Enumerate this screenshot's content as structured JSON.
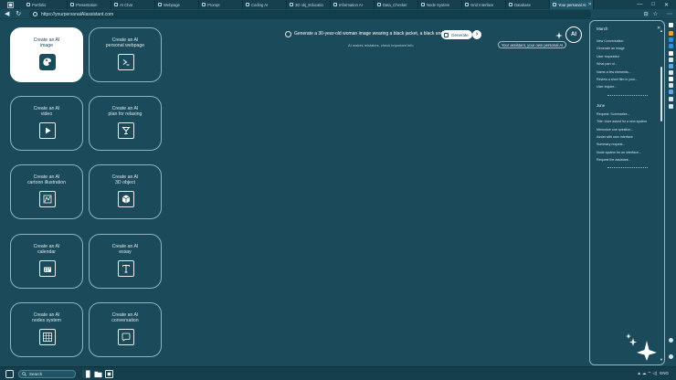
{
  "browser": {
    "tabs": [
      {
        "label": "Portfolio",
        "active": false
      },
      {
        "label": "Presentation",
        "active": false
      },
      {
        "label": "AI Chat",
        "active": false
      },
      {
        "label": "Webpage",
        "active": false
      },
      {
        "label": "Prompt",
        "active": false
      },
      {
        "label": "Coding AI",
        "active": false
      },
      {
        "label": "3D obj_Educatio",
        "active": false
      },
      {
        "label": "Information AI",
        "active": false
      },
      {
        "label": "Data_Checker",
        "active": false
      },
      {
        "label": "Node System",
        "active": false
      },
      {
        "label": "Grid Interface",
        "active": false
      },
      {
        "label": "Database",
        "active": false
      },
      {
        "label": "Your personal AI",
        "active": true
      }
    ],
    "url": "https://yourpersonalAIassistant.com",
    "window_controls": [
      "—",
      "□",
      "✕"
    ]
  },
  "cards": [
    {
      "label_1": "Create an AI",
      "label_2": "image",
      "icon": "image-icon",
      "selected": true
    },
    {
      "label_1": "Create an AI",
      "label_2": "personal webpage",
      "icon": "terminal-icon",
      "selected": false
    },
    {
      "label_1": "Create an AI",
      "label_2": "video",
      "icon": "play-icon",
      "selected": false
    },
    {
      "label_1": "Create an AI",
      "label_2": "plan for relaxing",
      "icon": "cocktail-icon",
      "selected": false
    },
    {
      "label_1": "Create an AI",
      "label_2": "cartoon illustration",
      "icon": "illustration-icon",
      "selected": false
    },
    {
      "label_1": "Create an AI",
      "label_2": "3D object",
      "icon": "cube-icon",
      "selected": false
    },
    {
      "label_1": "Create an AI",
      "label_2": "calendar",
      "icon": "calendar-icon",
      "selected": false
    },
    {
      "label_1": "Create an AI",
      "label_2": "essay",
      "icon": "text-icon",
      "selected": false
    },
    {
      "label_1": "Create an AI",
      "label_2": "nodes system",
      "icon": "grid-icon",
      "selected": false
    },
    {
      "label_1": "Create an AI",
      "label_2": "conversation",
      "icon": "chat-icon",
      "selected": false
    }
  ],
  "prompt": {
    "text": "Generate a 30-year-old woman image wearing a black jacket, a black and whit",
    "generate_label": "Generate",
    "send_label": "›",
    "disclaimer": "AI makes mistakes, check important info"
  },
  "assistant": {
    "logo_text": "AI",
    "tooltip": "Your assistant, your own personal AI"
  },
  "history": {
    "months": [
      {
        "name": "March",
        "items": [
          "New Conversation",
          "Generate an image",
          "User requested",
          "What part of...",
          "Name a few elements...",
          "Review a short film in your...",
          "User inquire..."
        ]
      },
      {
        "name": "June",
        "items": [
          "Request: Summarize...",
          "Title: User asked for a new system",
          "Memorize one question...",
          "Assist with user interface",
          "Summary request...",
          "Node system for an interface...",
          "Request the assistant..."
        ]
      }
    ]
  },
  "taskbar": {
    "search_placeholder": "Search",
    "tray_language": "ENG",
    "tray_icons": "▲ ☁ ⌔ ◁)"
  },
  "colors": {
    "background": "#1b4a5a",
    "card_border": "#8fb6c0",
    "selected_card": "#ffffff",
    "text": "#e6f0f2"
  }
}
